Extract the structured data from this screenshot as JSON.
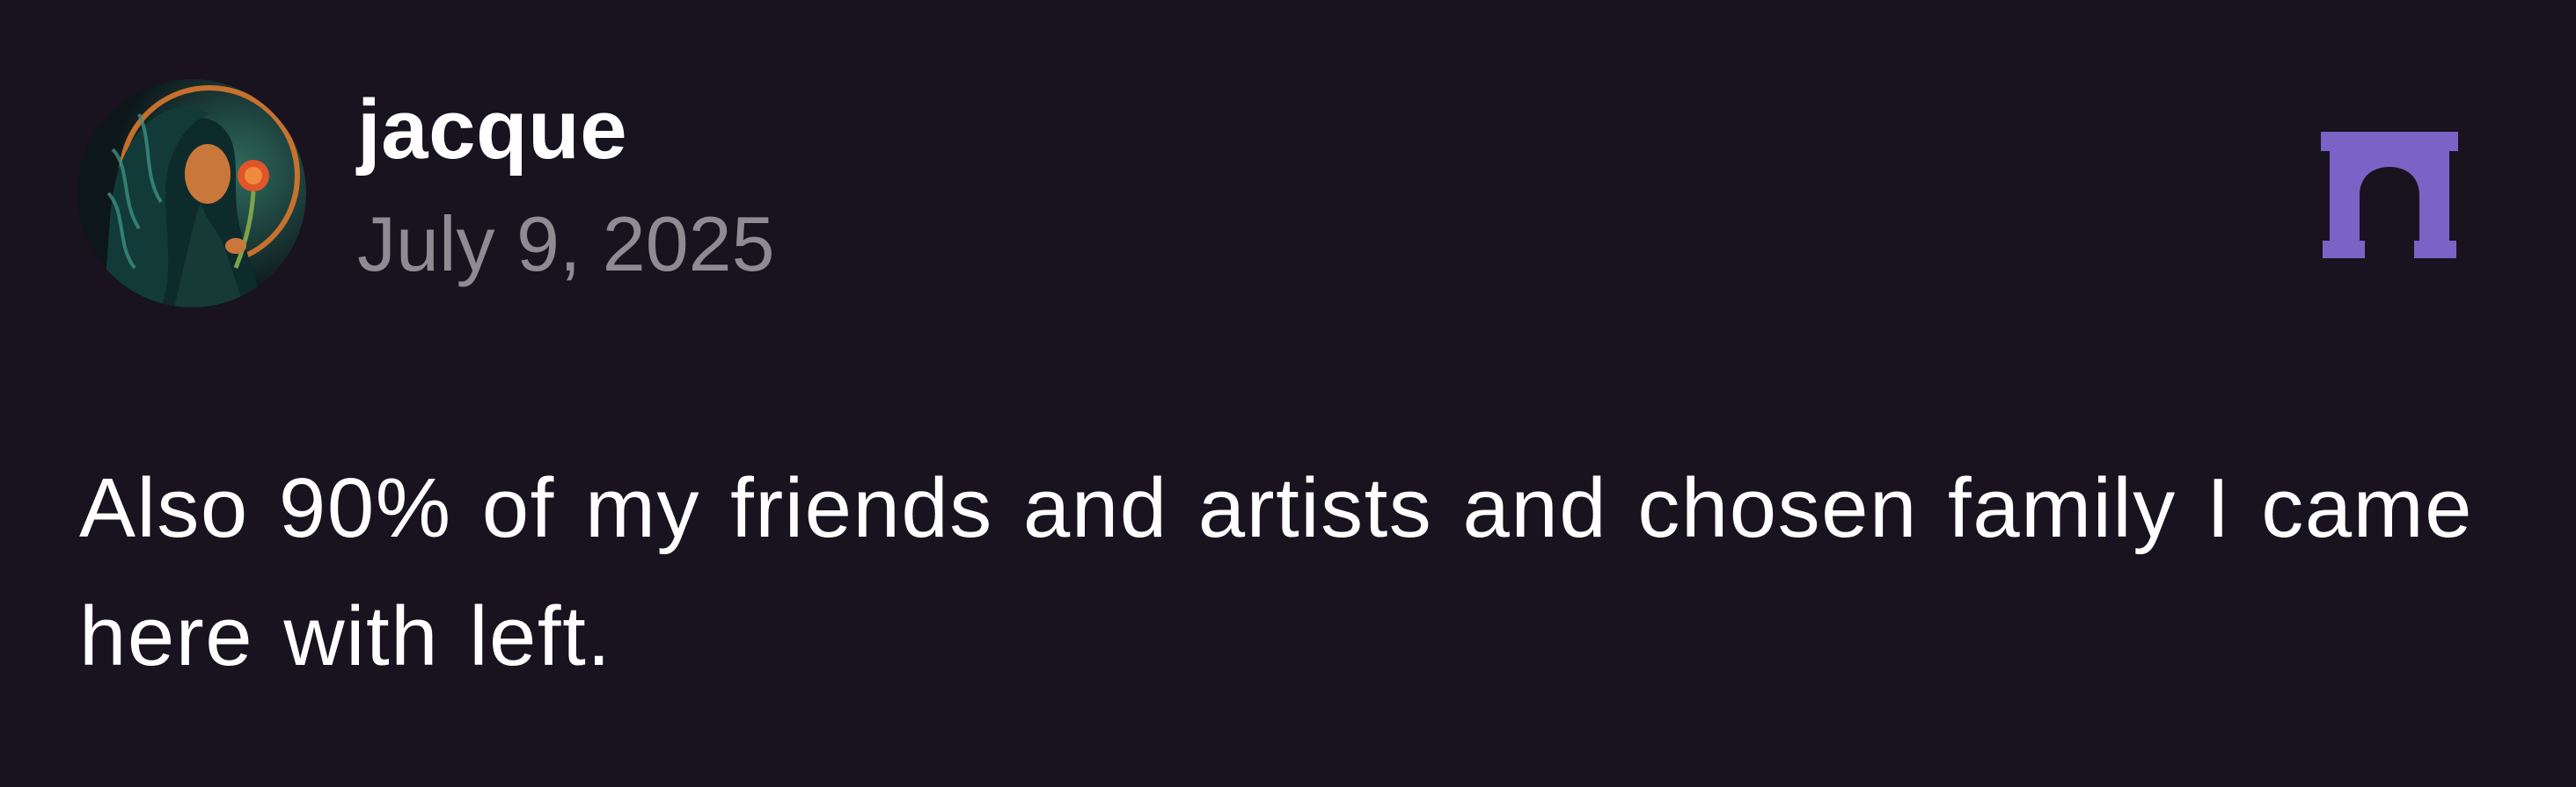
{
  "post": {
    "author": {
      "username": "jacque",
      "avatar_alt": "avatar"
    },
    "date": "July 9, 2025",
    "text": "Also 90% of my friends and artists and chosen family I came here with left.",
    "brand_icon": "arch-icon"
  },
  "colors": {
    "background": "#18131f",
    "username": "#ffffff",
    "date": "#8e8b93",
    "body_text": "#ffffff",
    "brand_accent": "#7b63c6"
  }
}
